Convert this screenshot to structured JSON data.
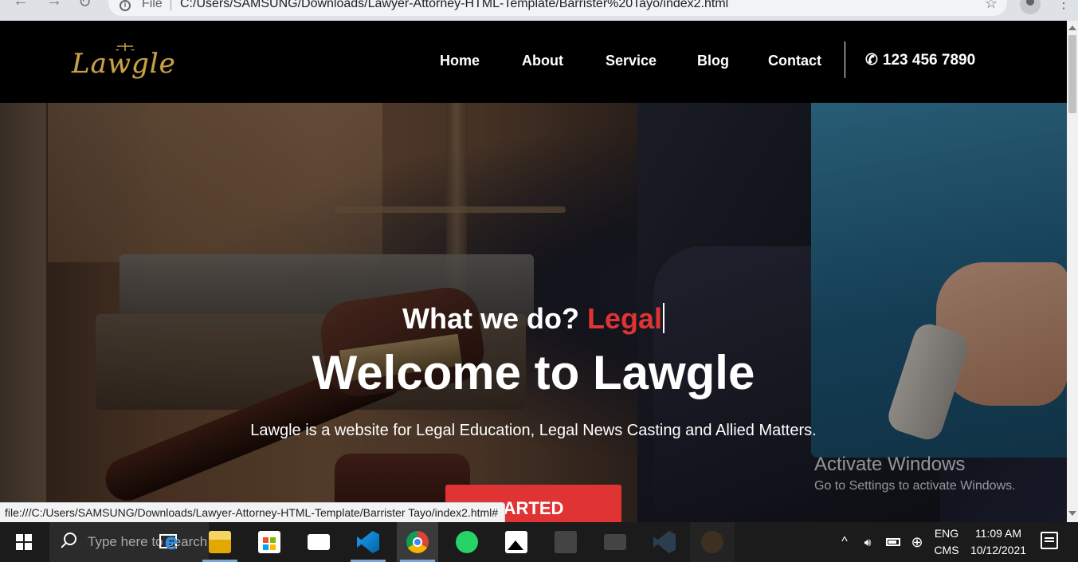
{
  "browser": {
    "file_label": "File",
    "url": "C:/Users/SAMSUNG/Downloads/Lawyer-Attorney-HTML-Template/Barrister%20Tayo/index2.html"
  },
  "site": {
    "logo_text": "Lawgle",
    "nav": [
      {
        "label": "Home"
      },
      {
        "label": "About"
      },
      {
        "label": "Service"
      },
      {
        "label": "Blog"
      },
      {
        "label": "Contact"
      }
    ],
    "phone": "123 456 7890"
  },
  "hero": {
    "subtitle_prefix": "What we do?",
    "subtitle_typed": "Legal",
    "title": "Welcome to Lawgle",
    "description": "Lawgle is a website for Legal Education, Legal News Casting and Allied Matters.",
    "cta_label": "ARTED"
  },
  "watermark": {
    "title": "Activate Windows",
    "subtitle": "Go to Settings to activate Windows."
  },
  "status_bar_url": "file:///C:/Users/SAMSUNG/Downloads/Lawyer-Attorney-HTML-Template/Barrister Tayo/index2.html#",
  "taskbar": {
    "search_placeholder": "Type here to search",
    "language_line1": "ENG",
    "language_line2": "CMS",
    "time": "11:09 AM",
    "date": "10/12/2021"
  },
  "colors": {
    "accent": "#e03434",
    "header_bg": "#000000",
    "logo_gold": "#c9a14a"
  }
}
